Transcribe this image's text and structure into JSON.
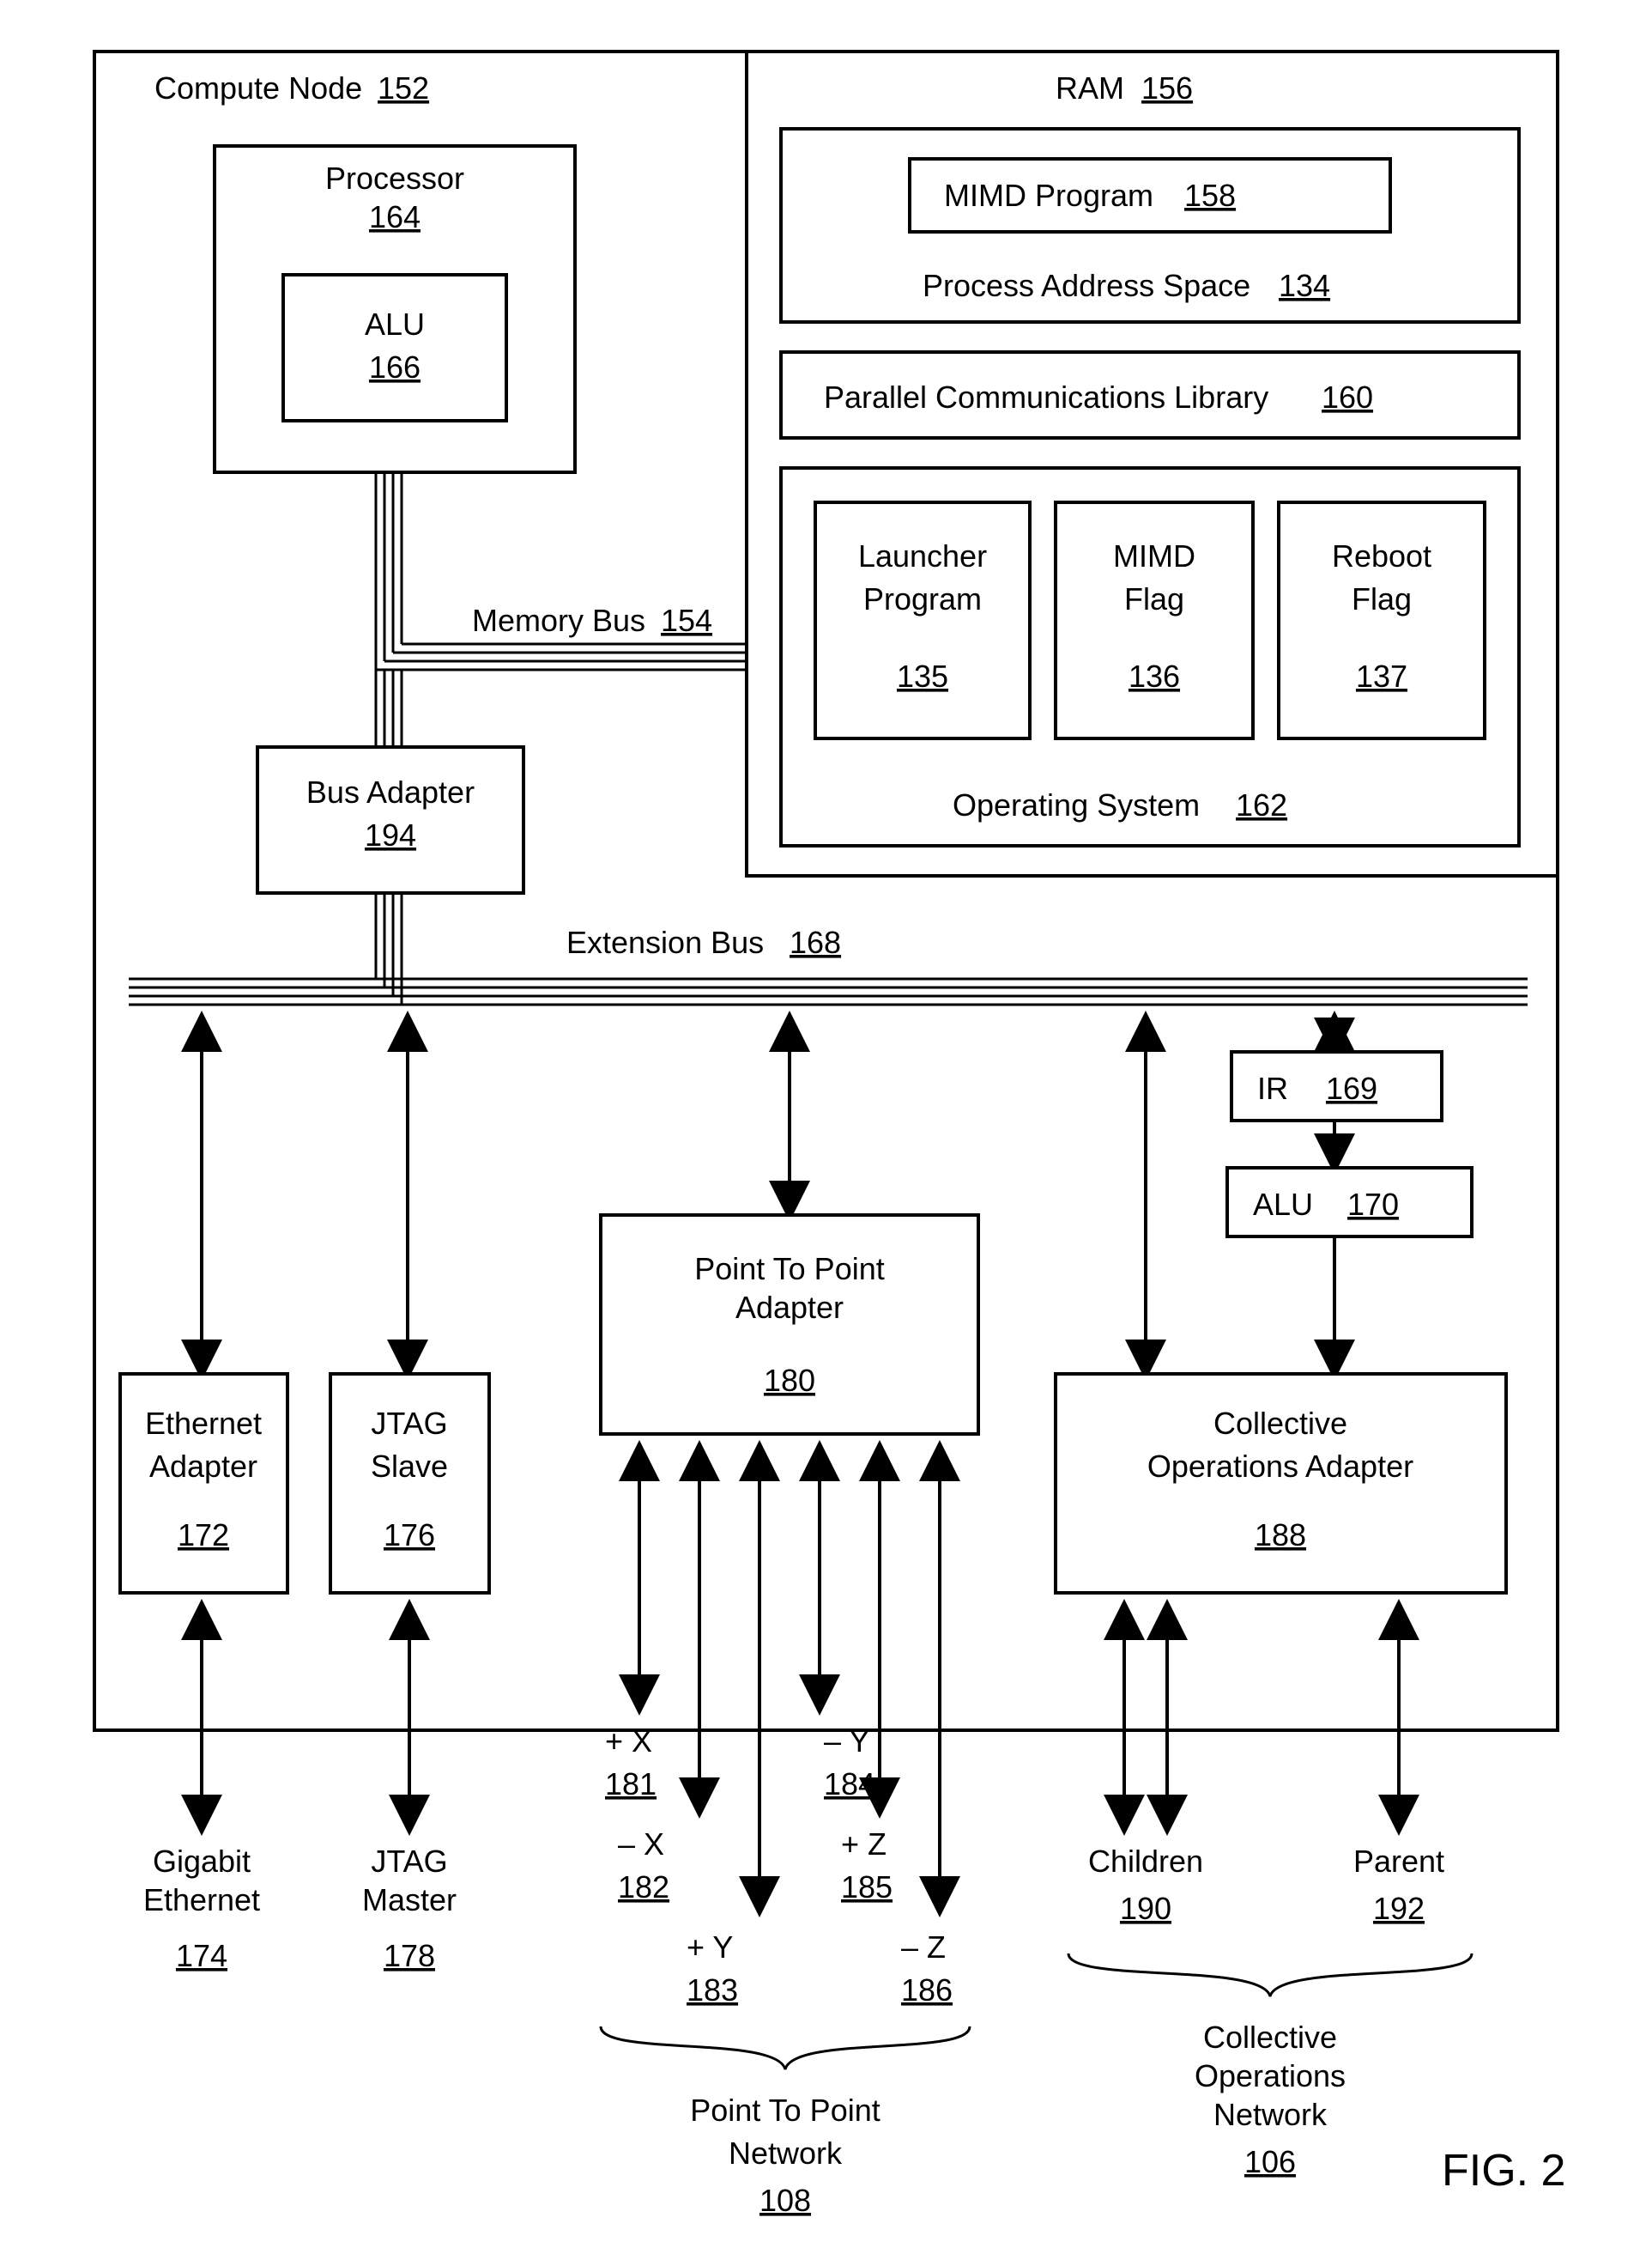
{
  "title": {
    "label": "Compute Node",
    "ref": "152"
  },
  "processor": {
    "label": "Processor",
    "ref": "164"
  },
  "alu1": {
    "label": "ALU",
    "ref": "166"
  },
  "ram": {
    "label": "RAM",
    "ref": "156"
  },
  "mimdProg": {
    "label": "MIMD Program",
    "ref": "158"
  },
  "pas": {
    "label": "Process Address Space",
    "ref": "134"
  },
  "pcl": {
    "label": "Parallel Communications Library",
    "ref": "160"
  },
  "launcher": {
    "label1": "Launcher",
    "label2": "Program",
    "ref": "135"
  },
  "mimdFlag": {
    "label1": "MIMD",
    "label2": "Flag",
    "ref": "136"
  },
  "rebootFlag": {
    "label1": "Reboot",
    "label2": "Flag",
    "ref": "137"
  },
  "os": {
    "label": "Operating System",
    "ref": "162"
  },
  "memBus": {
    "label": "Memory Bus",
    "ref": "154"
  },
  "busAdapter": {
    "label": "Bus Adapter",
    "ref": "194"
  },
  "extBus": {
    "label": "Extension Bus",
    "ref": "168"
  },
  "eth": {
    "label1": "Ethernet",
    "label2": "Adapter",
    "ref": "172"
  },
  "jtagS": {
    "label1": "JTAG",
    "label2": "Slave",
    "ref": "176"
  },
  "p2p": {
    "label1": "Point To Point",
    "label2": "Adapter",
    "ref": "180"
  },
  "coa": {
    "label1": "Collective",
    "label2": "Operations Adapter",
    "ref": "188"
  },
  "ir": {
    "label": "IR",
    "ref": "169"
  },
  "alu2": {
    "label": "ALU",
    "ref": "170"
  },
  "gige": {
    "label1": "Gigabit",
    "label2": "Ethernet",
    "ref": "174"
  },
  "jtagM": {
    "label1": "JTAG",
    "label2": "Master",
    "ref": "178"
  },
  "px": {
    "label": "+ X",
    "ref": "181"
  },
  "mx": {
    "label": "– X",
    "ref": "182"
  },
  "py": {
    "label": "+ Y",
    "ref": "183"
  },
  "my": {
    "label": "– Y",
    "ref": "184"
  },
  "pz": {
    "label": "+ Z",
    "ref": "185"
  },
  "mz": {
    "label": "– Z",
    "ref": "186"
  },
  "children": {
    "label": "Children",
    "ref": "190"
  },
  "parent": {
    "label": "Parent",
    "ref": "192"
  },
  "p2pNet": {
    "label1": "Point To Point",
    "label2": "Network",
    "ref": "108"
  },
  "coNet": {
    "label1": "Collective",
    "label2": "Operations",
    "label3": "Network",
    "ref": "106"
  },
  "fig": "FIG. 2"
}
